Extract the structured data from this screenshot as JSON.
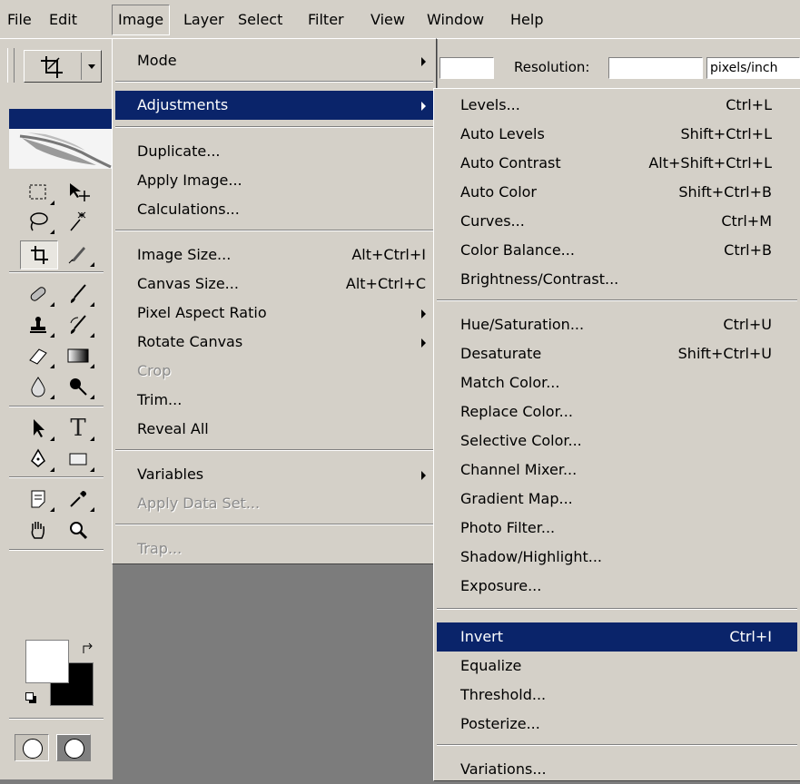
{
  "menubar": {
    "items": [
      "File",
      "Edit",
      "Image",
      "Layer",
      "Select",
      "Filter",
      "View",
      "Window",
      "Help"
    ],
    "active": "Image"
  },
  "options_bar": {
    "resolution_label": "Resolution:",
    "resolution_value": "",
    "units_value": "pixels/inch"
  },
  "image_menu": {
    "mode": "Mode",
    "adjustments": "Adjustments",
    "duplicate": "Duplicate...",
    "apply_image": "Apply Image...",
    "calculations": "Calculations...",
    "image_size": "Image Size...",
    "image_size_sc": "Alt+Ctrl+I",
    "canvas_size": "Canvas Size...",
    "canvas_size_sc": "Alt+Ctrl+C",
    "pixel_aspect": "Pixel Aspect Ratio",
    "rotate_canvas": "Rotate Canvas",
    "crop": "Crop",
    "trim": "Trim...",
    "reveal_all": "Reveal All",
    "variables": "Variables",
    "apply_data_set": "Apply Data Set...",
    "trap": "Trap..."
  },
  "adjustments_menu": {
    "levels": "Levels...",
    "levels_sc": "Ctrl+L",
    "auto_levels": "Auto Levels",
    "auto_levels_sc": "Shift+Ctrl+L",
    "auto_contrast": "Auto Contrast",
    "auto_contrast_sc": "Alt+Shift+Ctrl+L",
    "auto_color": "Auto Color",
    "auto_color_sc": "Shift+Ctrl+B",
    "curves": "Curves...",
    "curves_sc": "Ctrl+M",
    "color_balance": "Color Balance...",
    "color_balance_sc": "Ctrl+B",
    "brightness": "Brightness/Contrast...",
    "hue_sat": "Hue/Saturation...",
    "hue_sat_sc": "Ctrl+U",
    "desaturate": "Desaturate",
    "desaturate_sc": "Shift+Ctrl+U",
    "match_color": "Match Color...",
    "replace_color": "Replace Color...",
    "selective_color": "Selective Color...",
    "channel_mixer": "Channel Mixer...",
    "gradient_map": "Gradient Map...",
    "photo_filter": "Photo Filter...",
    "shadow_highlight": "Shadow/Highlight...",
    "exposure": "Exposure...",
    "invert": "Invert",
    "invert_sc": "Ctrl+I",
    "equalize": "Equalize",
    "threshold": "Threshold...",
    "posterize": "Posterize...",
    "variations": "Variations..."
  },
  "toolbox": {
    "tools": [
      "crop-tool-icon",
      "marquee-icon",
      "move-icon",
      "lasso-icon",
      "magic-wand-icon",
      "crop-icon",
      "slice-icon",
      "healing-brush-icon",
      "brush-icon",
      "clone-stamp-icon",
      "history-brush-icon",
      "eraser-icon",
      "gradient-icon",
      "blur-icon",
      "dodge-icon",
      "path-select-icon",
      "type-icon",
      "pen-icon",
      "shape-icon",
      "notes-icon",
      "eyedropper-icon",
      "hand-icon",
      "zoom-icon"
    ],
    "type_glyph": "T",
    "colors": {
      "foreground": "#000000",
      "background": "#ffffff",
      "highlight": "#0a246a"
    }
  }
}
